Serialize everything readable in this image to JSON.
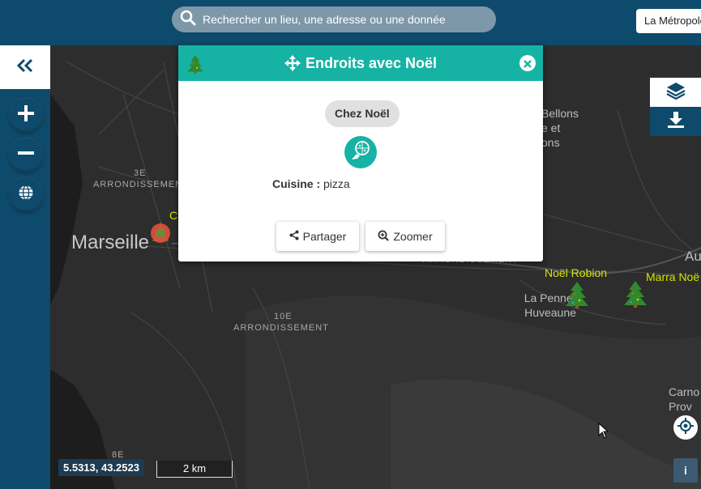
{
  "search": {
    "placeholder": "Rechercher un lieu, une adresse ou une donnée"
  },
  "scope": {
    "label": "La Métropole"
  },
  "map": {
    "labels": {
      "arr3_num": "3E",
      "arr3": "ARRONDISSEMENT",
      "arr10_num": "10E",
      "arr10": "ARRONDISSEMENT",
      "arr8_num": "8E",
      "arr_partial": "ARRONDISSEMENT",
      "marseille": "Marseille",
      "penne_1": "La Penne-",
      "penne_2": "Huveaune",
      "bellons_1": "Bellons",
      "bellons_2": "e et",
      "bellons_3": "ons",
      "aub": "Au",
      "carno": "Carno",
      "prov": "Prov"
    },
    "pois": {
      "noel_robion": "Noël Robion",
      "marra": "Marra Noë",
      "c_partial": "C"
    }
  },
  "popup": {
    "title": "Endroits avec Noël",
    "place": "Chez Noël",
    "attr_key": "Cuisine :",
    "attr_value": "pizza",
    "share": "Partager",
    "zoom": "Zoomer"
  },
  "footer": {
    "coords": "5.5313, 43.2523",
    "scale": "2 km",
    "info": "i"
  },
  "colors": {
    "brand": "#0e4a6b",
    "accent": "#16b3a5",
    "poi_label": "#d4e600"
  }
}
